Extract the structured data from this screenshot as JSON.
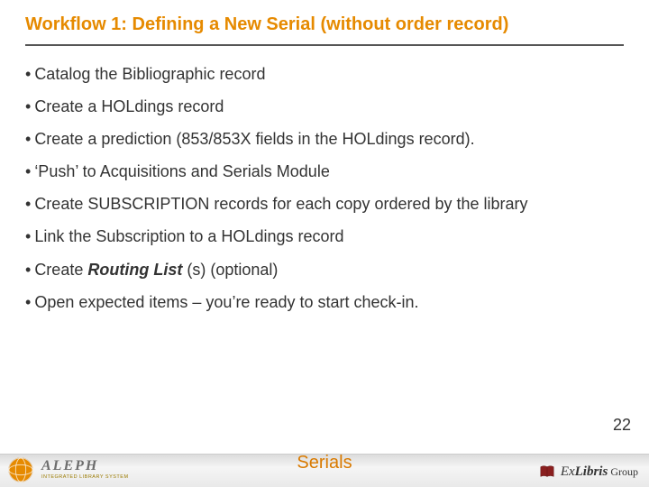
{
  "title": "Workflow 1: Defining a New Serial (without order record)",
  "bullets": {
    "b1": "Catalog the Bibliographic record",
    "b2": "Create a HOLdings record",
    "b3": "Create a prediction (853/853X fields in the HOLdings record).",
    "b4": "‘Push’ to Acquisitions and Serials Module",
    "b5": "Create SUBSCRIPTION records for each copy ordered by the library",
    "b6": "Link the Subscription to a HOLdings record",
    "b7_pre": "Create ",
    "b7_em": "Routing List",
    "b7_post": " (s) (optional)",
    "b8": "Open expected items – you’re ready to start check-in."
  },
  "footer": {
    "mid": "Serials",
    "aleph_main": "ALEPH",
    "aleph_sub": "INTEGRATED LIBRARY SYSTEM",
    "ex_ex": "Ex",
    "ex_libris": "Libris",
    "ex_group": " Group"
  },
  "page_number": "22"
}
